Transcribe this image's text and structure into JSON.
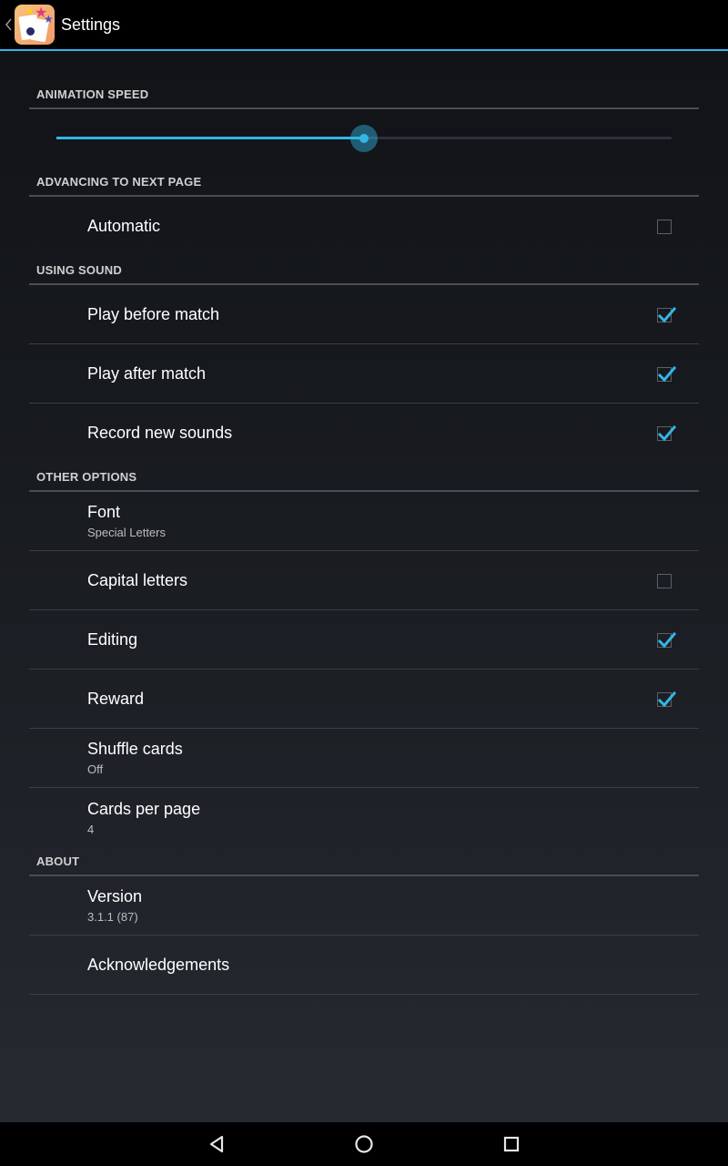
{
  "header": {
    "title": "Settings",
    "up_icon": "chevron-left-icon",
    "app_icon": "app-logo-icon"
  },
  "accent_color": "#33b5e5",
  "sections": {
    "animation": {
      "header": "ANIMATION SPEED",
      "slider_value": 0.5
    },
    "advancing": {
      "header": "ADVANCING TO NEXT PAGE",
      "automatic": {
        "title": "Automatic",
        "checked": false
      }
    },
    "sound": {
      "header": "USING SOUND",
      "play_before": {
        "title": "Play before match",
        "checked": true
      },
      "play_after": {
        "title": "Play after match",
        "checked": true
      },
      "record": {
        "title": "Record new sounds",
        "checked": true
      }
    },
    "other": {
      "header": "OTHER OPTIONS",
      "font": {
        "title": "Font",
        "summary": "Special Letters"
      },
      "capital": {
        "title": "Capital letters",
        "checked": false
      },
      "editing": {
        "title": "Editing",
        "checked": true
      },
      "reward": {
        "title": "Reward",
        "checked": true
      },
      "shuffle": {
        "title": "Shuffle cards",
        "summary": "Off"
      },
      "cards_per_page": {
        "title": "Cards per page",
        "summary": "4"
      }
    },
    "about": {
      "header": "ABOUT",
      "version": {
        "title": "Version",
        "summary": "3.1.1 (87)"
      },
      "ack": {
        "title": "Acknowledgements"
      }
    }
  },
  "navbar": {
    "back_icon": "back-triangle-icon",
    "home_icon": "home-circle-icon",
    "recents_icon": "recents-square-icon"
  }
}
